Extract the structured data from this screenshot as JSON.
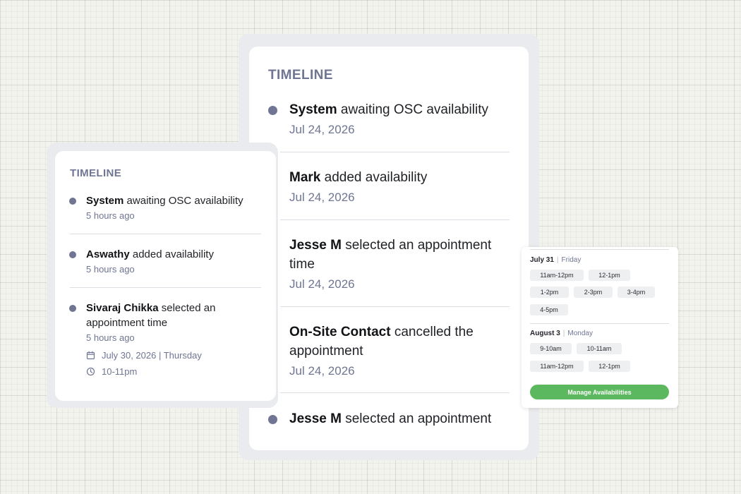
{
  "main_timeline": {
    "title": "TIMELINE",
    "items": [
      {
        "actor": "System",
        "action": "awaiting OSC availability",
        "date": "Jul 24, 2026"
      },
      {
        "actor": "Mark",
        "action": "added availability",
        "date": "Jul 24, 2026"
      },
      {
        "actor": "Jesse M",
        "action": "selected an appointment time",
        "date": "Jul 24, 2026"
      },
      {
        "actor": "On-Site Contact",
        "action": "cancelled the appointment",
        "date": "Jul 24, 2026"
      },
      {
        "actor": "Jesse M",
        "action": "selected an appointment"
      }
    ]
  },
  "secondary_timeline": {
    "title": "TIMELINE",
    "items": [
      {
        "actor": "System",
        "action": "awaiting OSC availability",
        "time_ago": "5 hours ago"
      },
      {
        "actor": "Aswathy",
        "action": "added availability",
        "time_ago": "5 hours ago"
      },
      {
        "actor": "Sivaraj Chikka",
        "action": "selected an appointment time",
        "time_ago": "5 hours ago"
      }
    ],
    "appointment": {
      "date": "July 30, 2026 | Thursday",
      "time": "10-11pm",
      "date_icon": "calendar-icon",
      "time_icon": "clock-icon"
    }
  },
  "availability": {
    "days": [
      {
        "date": "July 31",
        "weekday": "Friday",
        "slots": [
          "11am-12pm",
          "12-1pm",
          "1-2pm",
          "2-3pm",
          "3-4pm",
          "4-5pm"
        ]
      },
      {
        "date": "August 3",
        "weekday": "Monday",
        "slots": [
          "9-10am",
          "10-11am",
          "11am-12pm",
          "12-1pm"
        ]
      }
    ],
    "manage_label": "Manage Availabilities"
  },
  "colors": {
    "accent_muted": "#6f7593",
    "button_green": "#5cb85f",
    "divider": "#dcdde2"
  }
}
